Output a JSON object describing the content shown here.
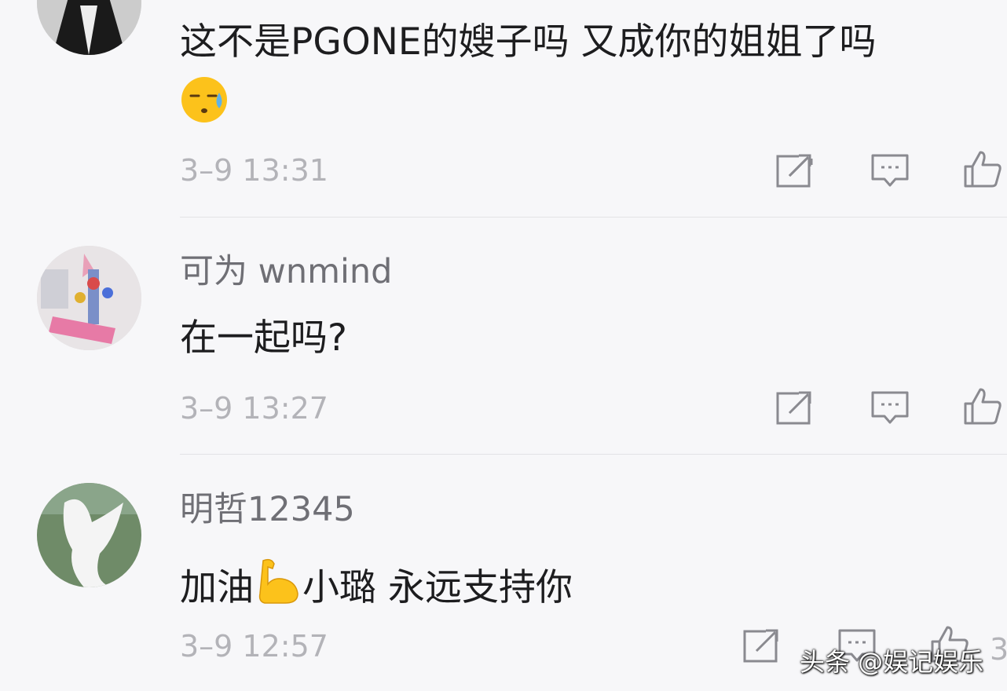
{
  "comments": [
    {
      "username": "",
      "text": "这不是PGONE的嫂子吗 又成你的姐姐了吗",
      "emoji": "downcast-face-with-sweat",
      "timestamp": "3–9 13:31"
    },
    {
      "username": "可为 wnmind",
      "text": "在一起吗?",
      "timestamp": "3–9 13:27"
    },
    {
      "username": "明哲12345",
      "text_before": "加油",
      "emoji": "flexed-biceps",
      "text_after": "小璐 永远支持你",
      "timestamp": "3–9 12:57"
    }
  ],
  "actions": {
    "share_icon": "share-icon",
    "reply_icon": "comment-icon",
    "like_icon": "thumbs-up-icon"
  },
  "watermark": "头条 @娱记娱乐",
  "partial_count": "3",
  "colors": {
    "background": "#f7f7f9",
    "username": "#6f6f75",
    "timestamp": "#b3b3b8",
    "icon": "#8a8a90"
  }
}
